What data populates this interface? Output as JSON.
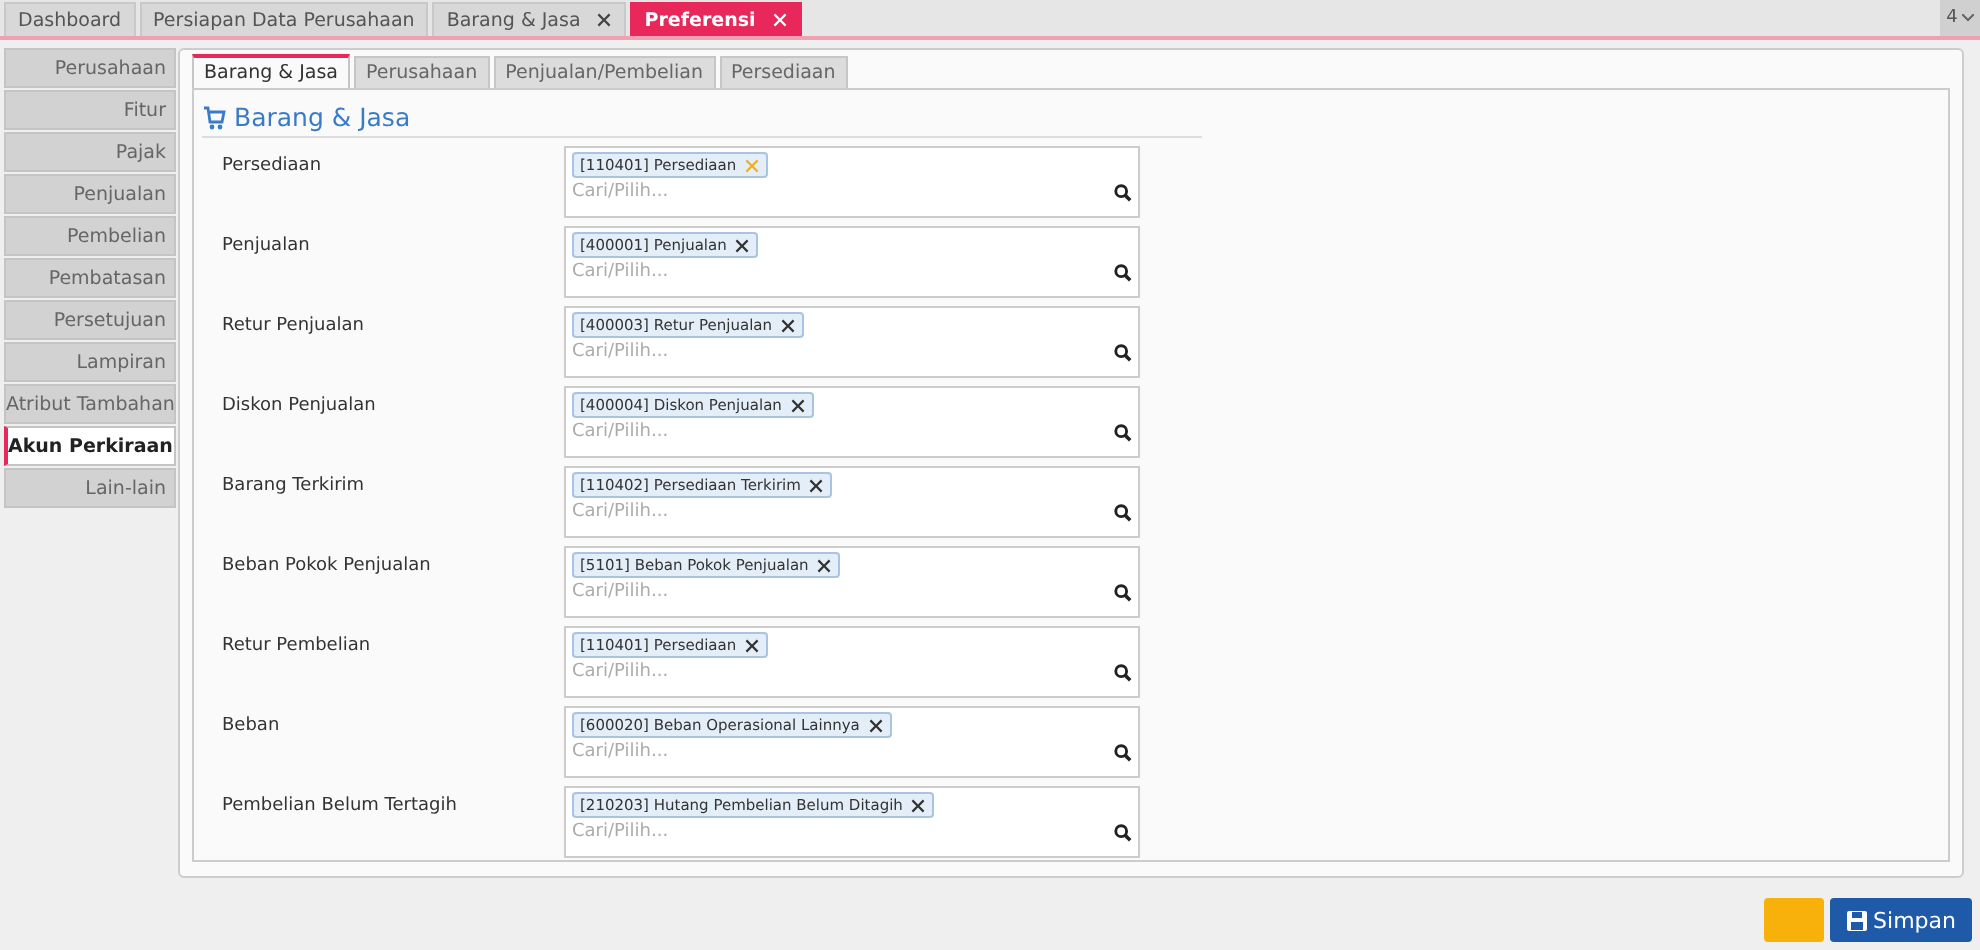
{
  "top_tabs": [
    {
      "label": "Dashboard",
      "closable": false,
      "selected": false
    },
    {
      "label": "Persiapan Data Perusahaan",
      "closable": false,
      "selected": false
    },
    {
      "label": "Barang & Jasa",
      "closable": true,
      "selected": false
    },
    {
      "label": "Preferensi",
      "closable": true,
      "selected": true
    }
  ],
  "tab_count": "4",
  "sidebar": {
    "items": [
      {
        "label": "Perusahaan",
        "selected": false
      },
      {
        "label": "Fitur",
        "selected": false
      },
      {
        "label": "Pajak",
        "selected": false
      },
      {
        "label": "Penjualan",
        "selected": false
      },
      {
        "label": "Pembelian",
        "selected": false
      },
      {
        "label": "Pembatasan",
        "selected": false
      },
      {
        "label": "Persetujuan",
        "selected": false
      },
      {
        "label": "Lampiran",
        "selected": false
      },
      {
        "label": "Atribut Tambahan",
        "selected": false
      },
      {
        "label": "Akun Perkiraan",
        "selected": true
      },
      {
        "label": "Lain-lain",
        "selected": false
      }
    ]
  },
  "sub_tabs": [
    {
      "label": "Barang & Jasa",
      "selected": true
    },
    {
      "label": "Perusahaan",
      "selected": false
    },
    {
      "label": "Penjualan/Pembelian",
      "selected": false
    },
    {
      "label": "Persediaan",
      "selected": false
    }
  ],
  "section_title": "Barang & Jasa",
  "fields": [
    {
      "label": "Persediaan",
      "tag": "[110401] Persediaan",
      "remove_highlighted": true,
      "placeholder": "Cari/Pilih..."
    },
    {
      "label": "Penjualan",
      "tag": "[400001] Penjualan",
      "remove_highlighted": false,
      "placeholder": "Cari/Pilih..."
    },
    {
      "label": "Retur Penjualan",
      "tag": "[400003] Retur Penjualan",
      "remove_highlighted": false,
      "placeholder": "Cari/Pilih..."
    },
    {
      "label": "Diskon Penjualan",
      "tag": "[400004] Diskon Penjualan",
      "remove_highlighted": false,
      "placeholder": "Cari/Pilih..."
    },
    {
      "label": "Barang Terkirim",
      "tag": "[110402] Persediaan Terkirim",
      "remove_highlighted": false,
      "placeholder": "Cari/Pilih..."
    },
    {
      "label": "Beban Pokok Penjualan",
      "tag": "[5101] Beban Pokok Penjualan",
      "remove_highlighted": false,
      "placeholder": "Cari/Pilih..."
    },
    {
      "label": "Retur Pembelian",
      "tag": "[110401] Persediaan",
      "remove_highlighted": false,
      "placeholder": "Cari/Pilih..."
    },
    {
      "label": "Beban",
      "tag": "[600020] Beban Operasional Lainnya",
      "remove_highlighted": false,
      "placeholder": "Cari/Pilih..."
    },
    {
      "label": "Pembelian Belum Tertagih",
      "tag": "[210203] Hutang Pembelian Belum Ditagih",
      "remove_highlighted": false,
      "placeholder": "Cari/Pilih..."
    }
  ],
  "buttons": [
    {
      "kind": "blank"
    },
    {
      "kind": "save",
      "label": "Simpan"
    }
  ]
}
